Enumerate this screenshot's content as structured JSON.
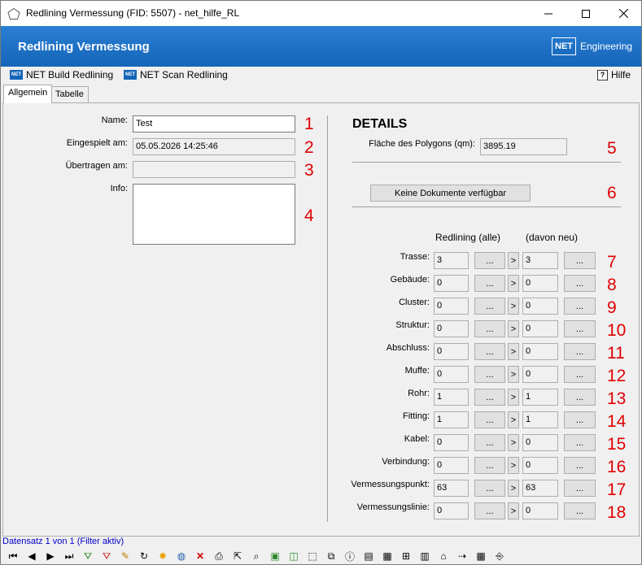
{
  "window": {
    "title": "Redlining Vermessung (FID: 5507) - net_hilfe_RL"
  },
  "banner": {
    "title": "Redlining Vermessung",
    "logo_text": "NET",
    "logo_suffix": "Engineering"
  },
  "toolbar": {
    "build_label": "NET Build Redlining",
    "scan_label": "NET Scan Redlining",
    "help_label": "Hilfe",
    "net_badge": "NET"
  },
  "tabs": [
    {
      "label": "Allgemein",
      "active": true
    },
    {
      "label": "Tabelle",
      "active": false
    }
  ],
  "general": {
    "name_label": "Name:",
    "name_value": "Test",
    "eingespielt_label": "Eingespielt am:",
    "eingespielt_value": "05.05.2026 14:25:46",
    "uebertragen_label": "Übertragen am:",
    "uebertragen_value": "",
    "info_label": "Info:",
    "info_value": ""
  },
  "details": {
    "heading": "DETAILS",
    "area_label": "Fläche des Polygons (qm):",
    "area_value": "3895.19",
    "docs_button": "Keine Dokumente verfügbar",
    "col_all": "Redlining (alle)",
    "col_new": "(davon neu)",
    "ellipsis": "...",
    "arrow": ">"
  },
  "rows": [
    {
      "label": "Trasse:",
      "all": "3",
      "new": "3",
      "no": "7"
    },
    {
      "label": "Gebäude:",
      "all": "0",
      "new": "0",
      "no": "8"
    },
    {
      "label": "Cluster:",
      "all": "0",
      "new": "0",
      "no": "9"
    },
    {
      "label": "Struktur:",
      "all": "0",
      "new": "0",
      "no": "10"
    },
    {
      "label": "Abschluss:",
      "all": "0",
      "new": "0",
      "no": "11"
    },
    {
      "label": "Muffe:",
      "all": "0",
      "new": "0",
      "no": "12"
    },
    {
      "label": "Rohr:",
      "all": "1",
      "new": "1",
      "no": "13"
    },
    {
      "label": "Fitting:",
      "all": "1",
      "new": "1",
      "no": "14"
    },
    {
      "label": "Kabel:",
      "all": "0",
      "new": "0",
      "no": "15"
    },
    {
      "label": "Verbindung:",
      "all": "0",
      "new": "0",
      "no": "16"
    },
    {
      "label": "Vermessungspunkt:",
      "all": "63",
      "new": "63",
      "no": "17"
    },
    {
      "label": "Vermessungslinie:",
      "all": "0",
      "new": "0",
      "no": "18"
    }
  ],
  "markers": {
    "m1": "1",
    "m2": "2",
    "m3": "3",
    "m4": "4",
    "m5": "5",
    "m6": "6"
  },
  "status": {
    "text": "Datensatz 1 von 1 (Filter aktiv)"
  },
  "colors": {
    "banner": "#1565b8",
    "marker_red": "#e00000",
    "status_blue": "#0000cc"
  }
}
